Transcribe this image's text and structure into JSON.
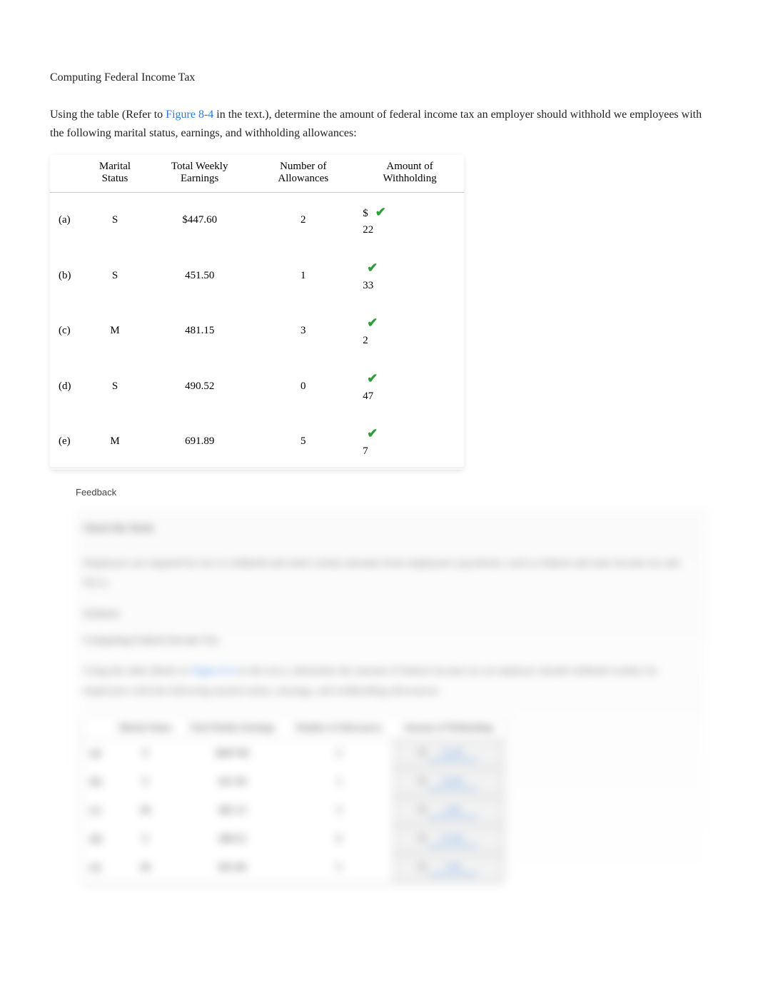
{
  "heading": "Computing Federal Income Tax",
  "intro_prefix": "Using the table (Refer to ",
  "intro_link": "Figure 8-4",
  "intro_suffix": " in the text.), determine the amount of federal income tax an employer should withhold we employees with the following marital status, earnings, and withholding allowances:",
  "columns": {
    "blank": "",
    "marital": "Marital Status",
    "earnings": "Total Weekly Earnings",
    "allowances": "Number of Allowances",
    "withholding": "Amount of Withholding"
  },
  "dollar_sign": "$",
  "check_icon": "✔",
  "rows": [
    {
      "label": "(a)",
      "marital": "S",
      "earnings": "$447.60",
      "allowances": "2",
      "withholding": "22",
      "show_dollar": true
    },
    {
      "label": "(b)",
      "marital": "S",
      "earnings": "451.50",
      "allowances": "1",
      "withholding": "33",
      "show_dollar": false
    },
    {
      "label": "(c)",
      "marital": "M",
      "earnings": "481.15",
      "allowances": "3",
      "withholding": "2",
      "show_dollar": false
    },
    {
      "label": "(d)",
      "marital": "S",
      "earnings": "490.52",
      "allowances": "0",
      "withholding": "47",
      "show_dollar": false
    },
    {
      "label": "(e)",
      "marital": "M",
      "earnings": "691.89",
      "allowances": "5",
      "withholding": "7",
      "show_dollar": false
    }
  ],
  "feedback_label": "Feedback",
  "blur": {
    "section_label": "Check My Work",
    "para": "Employers are required by law to withhold and remit certain amounts from employees' paychecks, such as federal and state income tax and FICA.",
    "solution_label": "Solution",
    "heading2": "Computing Federal Income Tax",
    "intro2_prefix": "Using the table (Refer to ",
    "intro2_link": "Figure 8-4",
    "intro2_suffix": " in the text.), determine the amount of federal income tax an employer should withhold weekly for employees with the following marital status, earnings, and withholding allowances:",
    "rows": [
      {
        "label": "(a)",
        "marital": "S",
        "earnings": "$447.60",
        "allowances": "2",
        "ans": "22.00"
      },
      {
        "label": "(b)",
        "marital": "S",
        "earnings": "451.50",
        "allowances": "1",
        "ans": "33.00"
      },
      {
        "label": "(c)",
        "marital": "M",
        "earnings": "481.15",
        "allowances": "3",
        "ans": "2.00"
      },
      {
        "label": "(d)",
        "marital": "S",
        "earnings": "490.52",
        "allowances": "0",
        "ans": "47.00"
      },
      {
        "label": "(e)",
        "marital": "M",
        "earnings": "691.89",
        "allowances": "5",
        "ans": "7.00"
      }
    ]
  }
}
